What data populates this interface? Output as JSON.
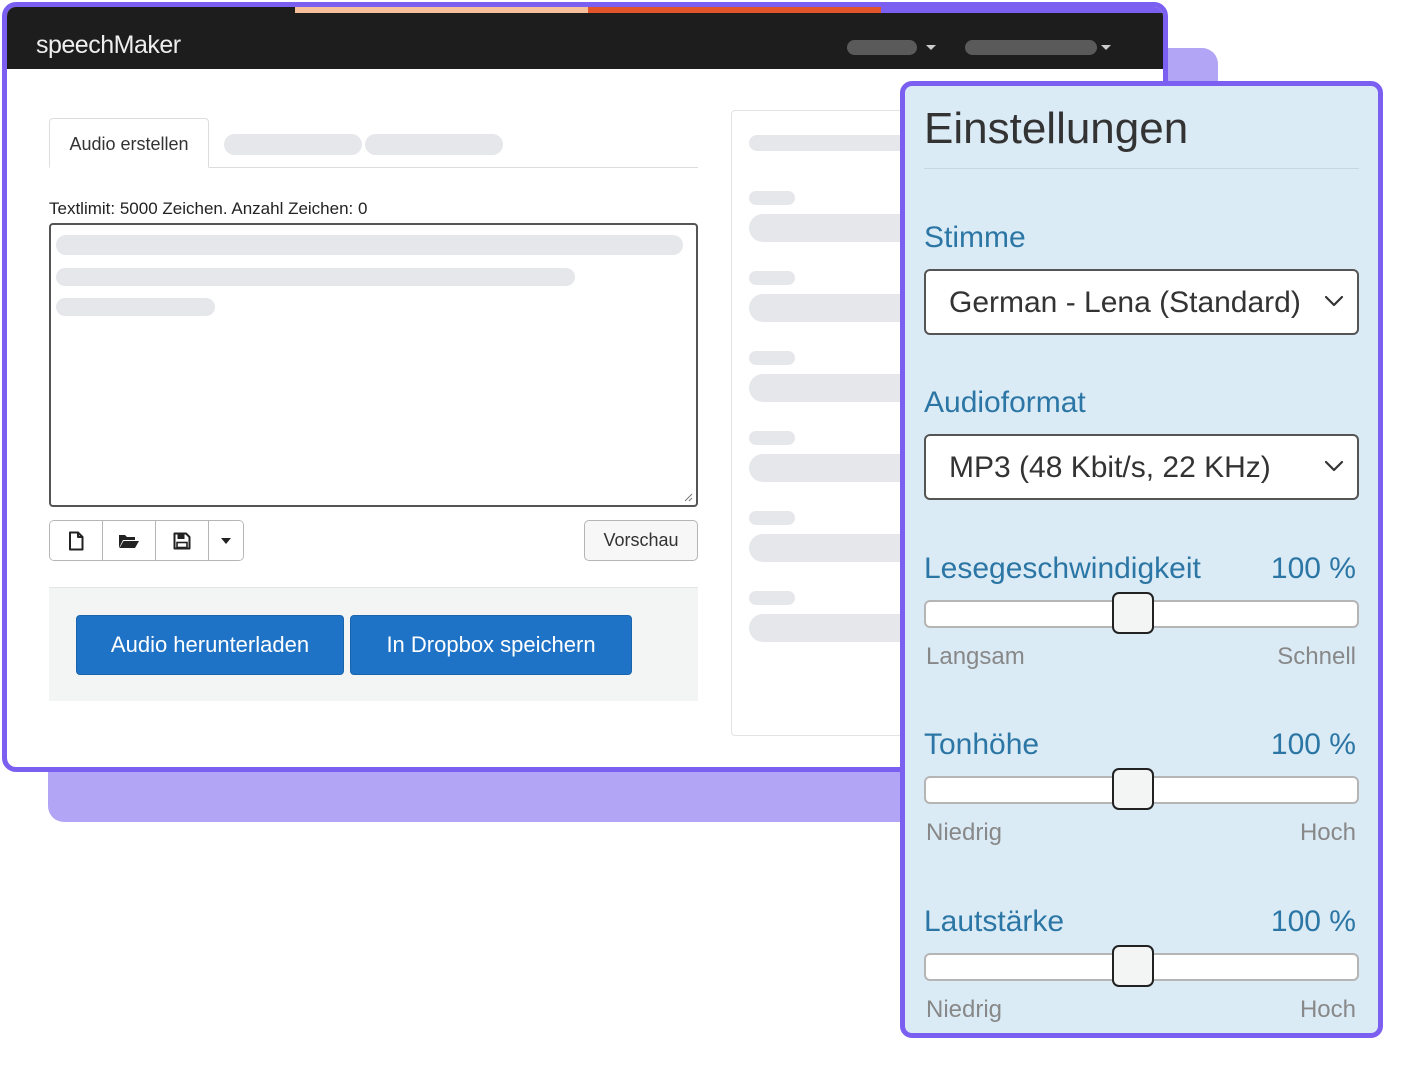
{
  "colors": {
    "accent_purple": "#7b5ff0",
    "shadow_purple": "#b3a5f5",
    "navbar_bg": "#1d1d1d",
    "primary_button": "#1f73c6",
    "settings_bg": "#dbebf6",
    "label_blue": "#2b76a4",
    "stripe": [
      "#1d1d1d",
      "#f6bf9c",
      "#e2542a",
      "#7b5ff0"
    ]
  },
  "navbar": {
    "brand": "speechMaker",
    "menus": [
      {
        "icon": "caret-down-icon"
      },
      {
        "icon": "caret-down-icon"
      }
    ]
  },
  "tabs": [
    {
      "label": "Audio erstellen",
      "active": true
    }
  ],
  "editor": {
    "text_limit": "Textlimit: 5000 Zeichen. Anzahl Zeichen: 0",
    "toolbar_icons": [
      "new-file-icon",
      "open-folder-icon",
      "save-icon",
      "caret-down-icon"
    ],
    "preview_label": "Vorschau"
  },
  "actions": {
    "download_label": "Audio herunterladen",
    "dropbox_label": "In Dropbox speichern"
  },
  "settings": {
    "title": "Einstellungen",
    "voice": {
      "label": "Stimme",
      "value": "German - Lena (Standard)"
    },
    "format": {
      "label": "Audioformat",
      "value": "MP3 (48 Kbit/s, 22 KHz)"
    },
    "speed": {
      "label": "Lesegeschwindigkeit",
      "value": "100 %",
      "level": 0.48,
      "min_label": "Langsam",
      "max_label": "Schnell"
    },
    "pitch": {
      "label": "Tonhöhe",
      "value": "100 %",
      "level": 0.48,
      "min_label": "Niedrig",
      "max_label": "Hoch"
    },
    "volume": {
      "label": "Lautstärke",
      "value": "100 %",
      "level": 0.48,
      "min_label": "Niedrig",
      "max_label": "Hoch"
    }
  }
}
